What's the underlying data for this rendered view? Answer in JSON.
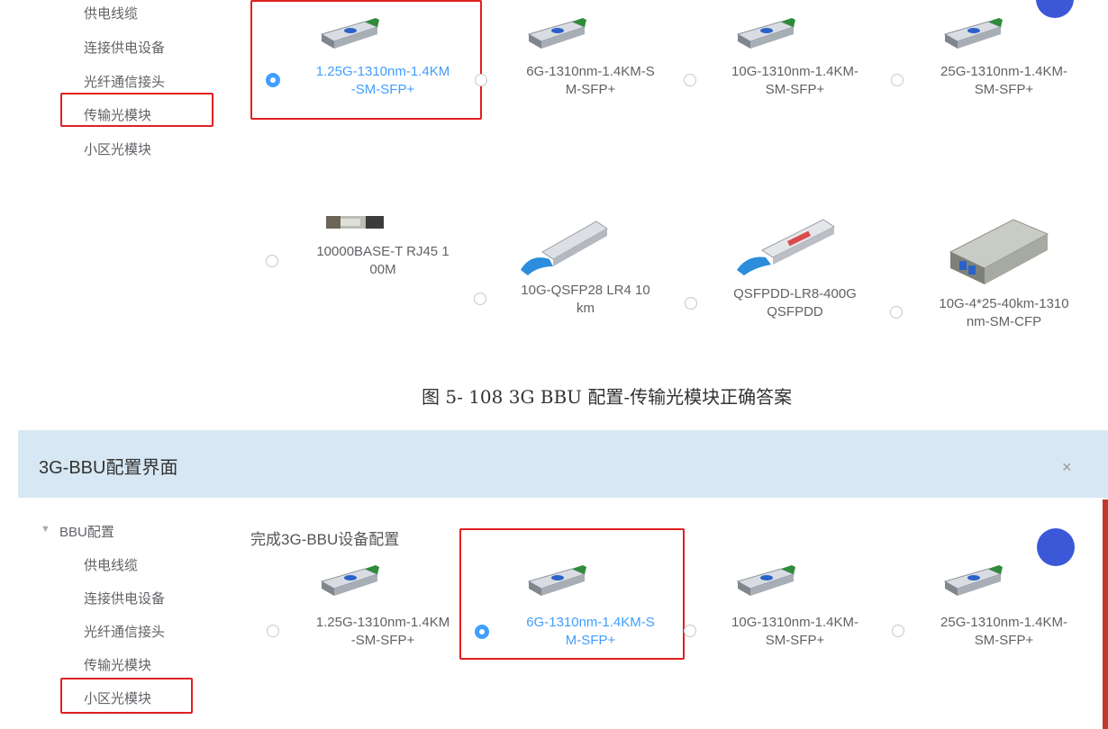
{
  "top_section": {
    "sidebar": [
      "供电线缆",
      "连接供电设备",
      "光纤通信接头",
      "传输光模块",
      "小区光模块"
    ],
    "modules_row1": [
      {
        "label": "1.25G-1310nm-1.4KM\n-SM-SFP+",
        "selected": true,
        "icon": "sfp-module-icon"
      },
      {
        "label": "6G-1310nm-1.4KM-S\nM-SFP+",
        "selected": false,
        "icon": "sfp-module-icon"
      },
      {
        "label": "10G-1310nm-1.4KM-\nSM-SFP+",
        "selected": false,
        "icon": "sfp-module-icon"
      },
      {
        "label": "25G-1310nm-1.4KM-\nSM-SFP+",
        "selected": false,
        "icon": "sfp-module-icon"
      }
    ],
    "modules_row2": [
      {
        "label": "10000BASE-T RJ45 1\n00M",
        "selected": false,
        "icon": "rj45-module-icon"
      },
      {
        "label": "10G-QSFP28 LR4 10\nkm",
        "selected": false,
        "icon": "qsfp28-module-icon"
      },
      {
        "label": "QSFPDD-LR8-400G\nQSFPDD",
        "selected": false,
        "icon": "qsfpdd-module-icon"
      },
      {
        "label": "10G-4*25-40km-1310\nnm-SM-CFP",
        "selected": false,
        "icon": "cfp-module-icon"
      }
    ]
  },
  "caption": "图 5- 108 3G BBU 配置-传输光模块正确答案",
  "dialog": {
    "title": "3G-BBU配置界面",
    "close": "×",
    "tree_root": "BBU配置",
    "sidebar": [
      "供电线缆",
      "连接供电设备",
      "光纤通信接头",
      "传输光模块",
      "小区光模块"
    ],
    "heading": "完成3G-BBU设备配置",
    "modules": [
      {
        "label": "1.25G-1310nm-1.4KM\n-SM-SFP+",
        "selected": false,
        "icon": "sfp-module-icon"
      },
      {
        "label": "6G-1310nm-1.4KM-S\nM-SFP+",
        "selected": true,
        "icon": "sfp-module-icon"
      },
      {
        "label": "10G-1310nm-1.4KM-\nSM-SFP+",
        "selected": false,
        "icon": "sfp-module-icon"
      },
      {
        "label": "25G-1310nm-1.4KM-\nSM-SFP+",
        "selected": false,
        "icon": "sfp-module-icon"
      }
    ]
  },
  "colors": {
    "accent": "#409eff",
    "highlight_box": "#e02020",
    "dialog_header": "#d7e8f4",
    "gear": "#3b58d8"
  }
}
